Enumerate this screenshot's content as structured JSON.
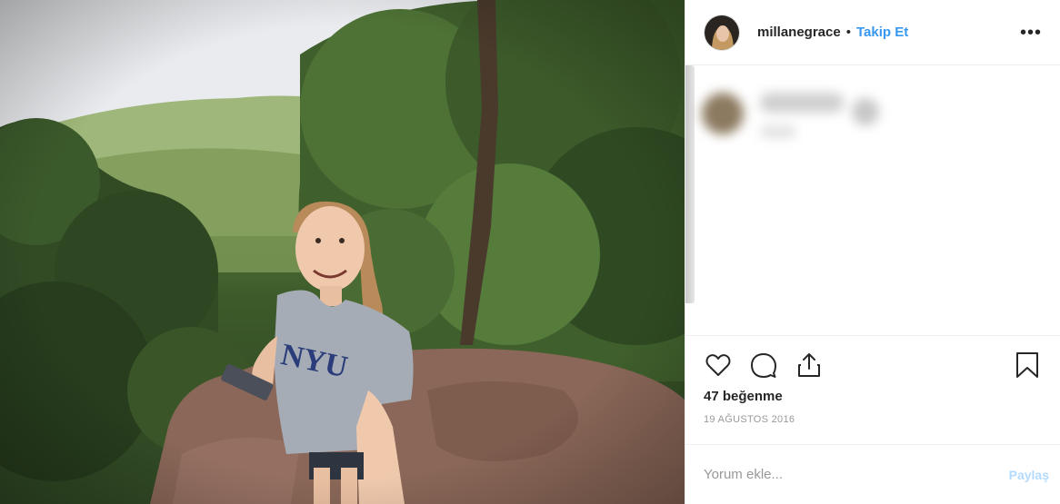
{
  "post": {
    "photo_icon": "selfie-photo",
    "username": "millanegrace",
    "separator": "•",
    "follow_label": "Takip Et",
    "more_label": "•••",
    "likes_text": "47 beğenme",
    "date_text": "19 AĞUSTOS 2016"
  },
  "comment_form": {
    "placeholder": "Yorum ekle...",
    "post_label": "Paylaş"
  },
  "colors": {
    "accent": "#3897f0",
    "post_disabled": "#b3dbff",
    "text": "#262626",
    "muted": "#999999"
  },
  "icons": [
    "heart-icon",
    "comment-icon",
    "share-icon",
    "bookmark-icon",
    "more-options-icon"
  ]
}
